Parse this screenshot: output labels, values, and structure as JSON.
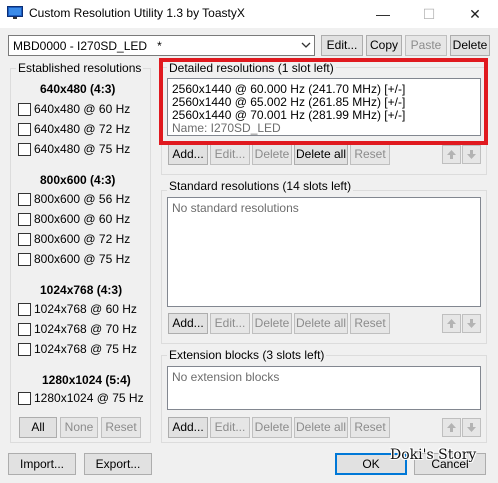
{
  "window": {
    "title": "Custom Resolution Utility 1.3 by ToastyX"
  },
  "profile": {
    "selected": "MBD0000 - I270SD_LED   *",
    "edit": "Edit...",
    "copy": "Copy",
    "paste": "Paste",
    "delete": "Delete"
  },
  "established": {
    "title": "Established resolutions",
    "sections": [
      {
        "heading": "640x480 (4:3)",
        "items": [
          "640x480 @ 60 Hz",
          "640x480 @ 72 Hz",
          "640x480 @ 75 Hz"
        ]
      },
      {
        "heading": "800x600 (4:3)",
        "items": [
          "800x600 @ 56 Hz",
          "800x600 @ 60 Hz",
          "800x600 @ 72 Hz",
          "800x600 @ 75 Hz"
        ]
      },
      {
        "heading": "1024x768 (4:3)",
        "items": [
          "1024x768 @ 60 Hz",
          "1024x768 @ 70 Hz",
          "1024x768 @ 75 Hz"
        ]
      },
      {
        "heading": "1280x1024 (5:4)",
        "items": [
          "1280x1024 @ 75 Hz"
        ]
      }
    ],
    "all": "All",
    "none": "None",
    "reset": "Reset"
  },
  "detailed": {
    "title": "Detailed resolutions (1 slot left)",
    "items": [
      "2560x1440 @ 60.000 Hz (241.70 MHz) [+/-]",
      "2560x1440 @ 65.002 Hz (261.85 MHz) [+/-]",
      "2560x1440 @ 70.001 Hz (281.99 MHz) [+/-]"
    ],
    "name_line": "Name: I270SD_LED",
    "add": "Add...",
    "edit": "Edit...",
    "delete": "Delete",
    "delete_all": "Delete all",
    "reset": "Reset"
  },
  "standard": {
    "title": "Standard resolutions (14 slots left)",
    "empty": "No standard resolutions",
    "add": "Add...",
    "edit": "Edit...",
    "delete": "Delete",
    "delete_all": "Delete all",
    "reset": "Reset"
  },
  "extension": {
    "title": "Extension blocks (3 slots left)",
    "empty": "No extension blocks",
    "add": "Add...",
    "edit": "Edit...",
    "delete": "Delete",
    "delete_all": "Delete all",
    "reset": "Reset"
  },
  "footer": {
    "import": "Import...",
    "export": "Export...",
    "ok": "OK",
    "cancel": "Cancel"
  },
  "watermark": "Doki's Story",
  "colors": {
    "highlight": "#e0191f",
    "focus": "#0078d7"
  }
}
